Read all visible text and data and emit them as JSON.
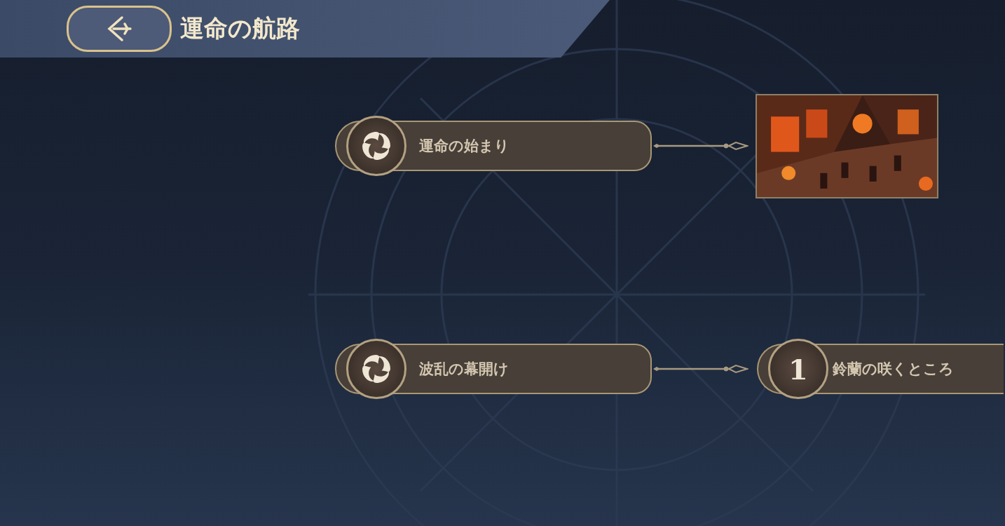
{
  "header": {
    "title": "運命の航路"
  },
  "routes": [
    {
      "node": {
        "kind": "swirl",
        "label": "運命の始まり"
      }
    },
    {
      "node": {
        "kind": "swirl",
        "label": "波乱の幕開け"
      },
      "target": {
        "kind": "node",
        "badge": "1",
        "label": "鈴蘭の咲くところ"
      }
    }
  ]
}
